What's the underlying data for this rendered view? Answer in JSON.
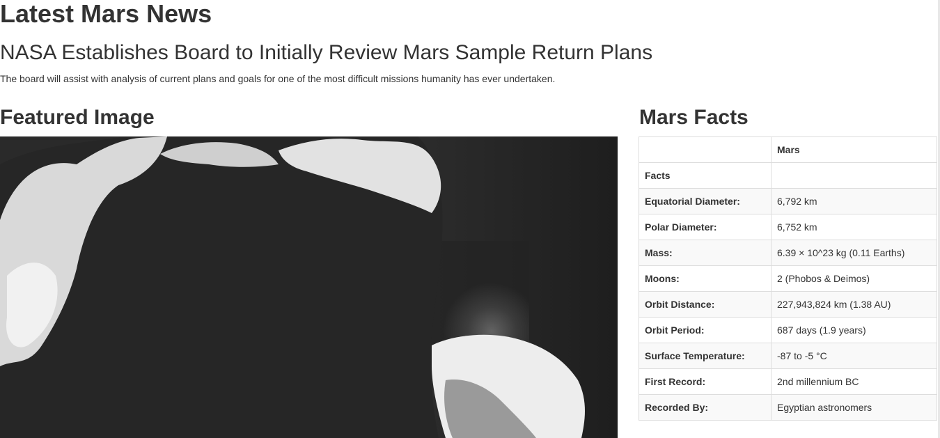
{
  "header": {
    "latest_title": "Latest Mars News"
  },
  "news": {
    "title": "NASA Establishes Board to Initially Review Mars Sample Return Plans",
    "teaser": "The board will assist with analysis of current plans and goals for one of the most difficult missions humanity has ever undertaken."
  },
  "featured": {
    "title": "Featured Image",
    "image_subject": "comet surface photograph (grayscale)"
  },
  "facts": {
    "title": "Mars Facts",
    "header_col2": "Mars",
    "rows": [
      {
        "label": "Facts",
        "value": ""
      },
      {
        "label": "Equatorial Diameter:",
        "value": "6,792 km"
      },
      {
        "label": "Polar Diameter:",
        "value": "6,752 km"
      },
      {
        "label": "Mass:",
        "value": "6.39 × 10^23 kg (0.11 Earths)"
      },
      {
        "label": "Moons:",
        "value": "2 (Phobos & Deimos)"
      },
      {
        "label": "Orbit Distance:",
        "value": "227,943,824 km (1.38 AU)"
      },
      {
        "label": "Orbit Period:",
        "value": "687 days (1.9 years)"
      },
      {
        "label": "Surface Temperature:",
        "value": "-87 to -5 °C"
      },
      {
        "label": "First Record:",
        "value": "2nd millennium BC"
      },
      {
        "label": "Recorded By:",
        "value": "Egyptian astronomers"
      }
    ]
  }
}
